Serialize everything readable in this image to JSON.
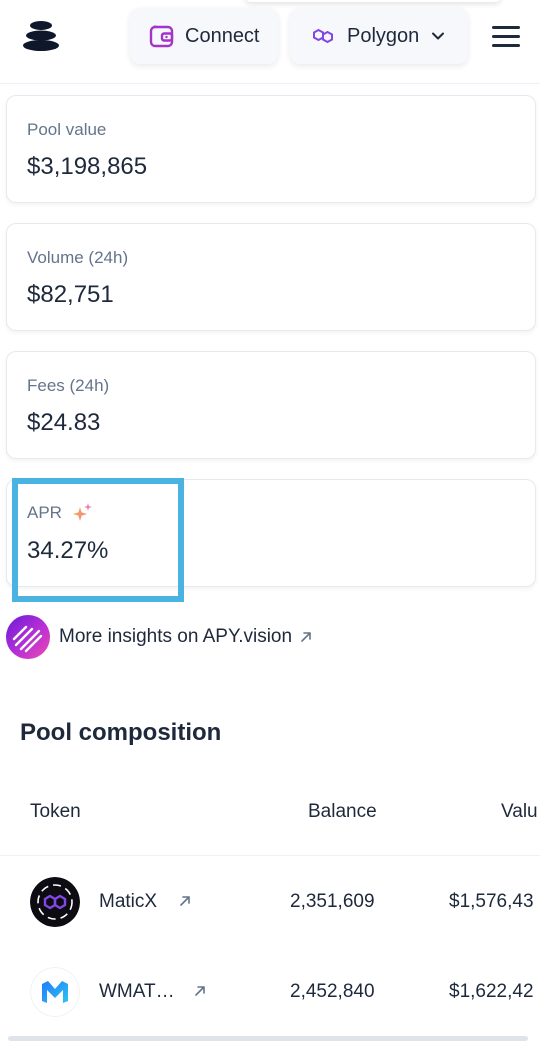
{
  "header": {
    "connect_label": "Connect",
    "network_label": "Polygon",
    "logo_icon": "balancer-logo-icon",
    "menu_icon": "hamburger-menu-icon"
  },
  "stats": [
    {
      "label": "Pool value",
      "value": "$3,198,865"
    },
    {
      "label": "Volume (24h)",
      "value": "$82,751"
    },
    {
      "label": "Fees (24h)",
      "value": "$24.83"
    },
    {
      "label": "APR",
      "value": "34.27%"
    }
  ],
  "insights": {
    "text": "More insights on APY.vision"
  },
  "pool_composition": {
    "title": "Pool composition",
    "columns": [
      "Token",
      "Balance",
      "Valu"
    ],
    "rows": [
      {
        "token": "MaticX",
        "balance": "2,351,609",
        "value": "$1,576,43"
      },
      {
        "token": "WMAT…",
        "balance": "2,452,840",
        "value": "$1,622,42"
      }
    ]
  },
  "colors": {
    "text": "#1e293b",
    "muted": "#64748b",
    "highlight": "#4ab3e2",
    "polygon_purple": "#8247e5",
    "connect_icon": "#a433c9"
  }
}
